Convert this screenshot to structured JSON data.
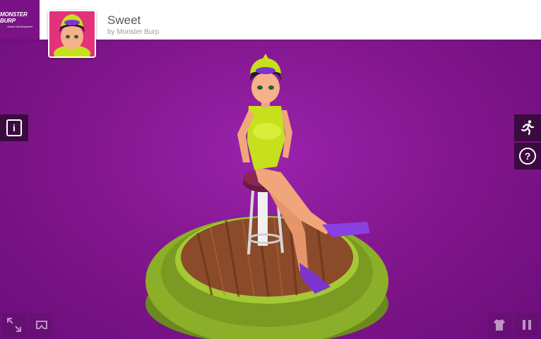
{
  "brand": {
    "name": "MONSTER BURP",
    "tagline": "Game Development"
  },
  "model": {
    "title": "Sweet",
    "author": "by Monster Burp"
  },
  "controls": {
    "info_icon": "i",
    "help_icon": "?",
    "animation_icon": "running-figure-icon",
    "fullscreen_icon": "expand-arrows-icon",
    "vr_icon": "cardboard-icon",
    "model_inspector_icon": "shirt-icon",
    "pause_icon": "pause-icon"
  },
  "colors": {
    "header_bg": "#ffffff",
    "brand_bg": "#7b1287",
    "scene_bg": "#84178f",
    "swimsuit": "#c6e01b",
    "flippers": "#8a3fe0",
    "platform": "#8caf2a"
  }
}
